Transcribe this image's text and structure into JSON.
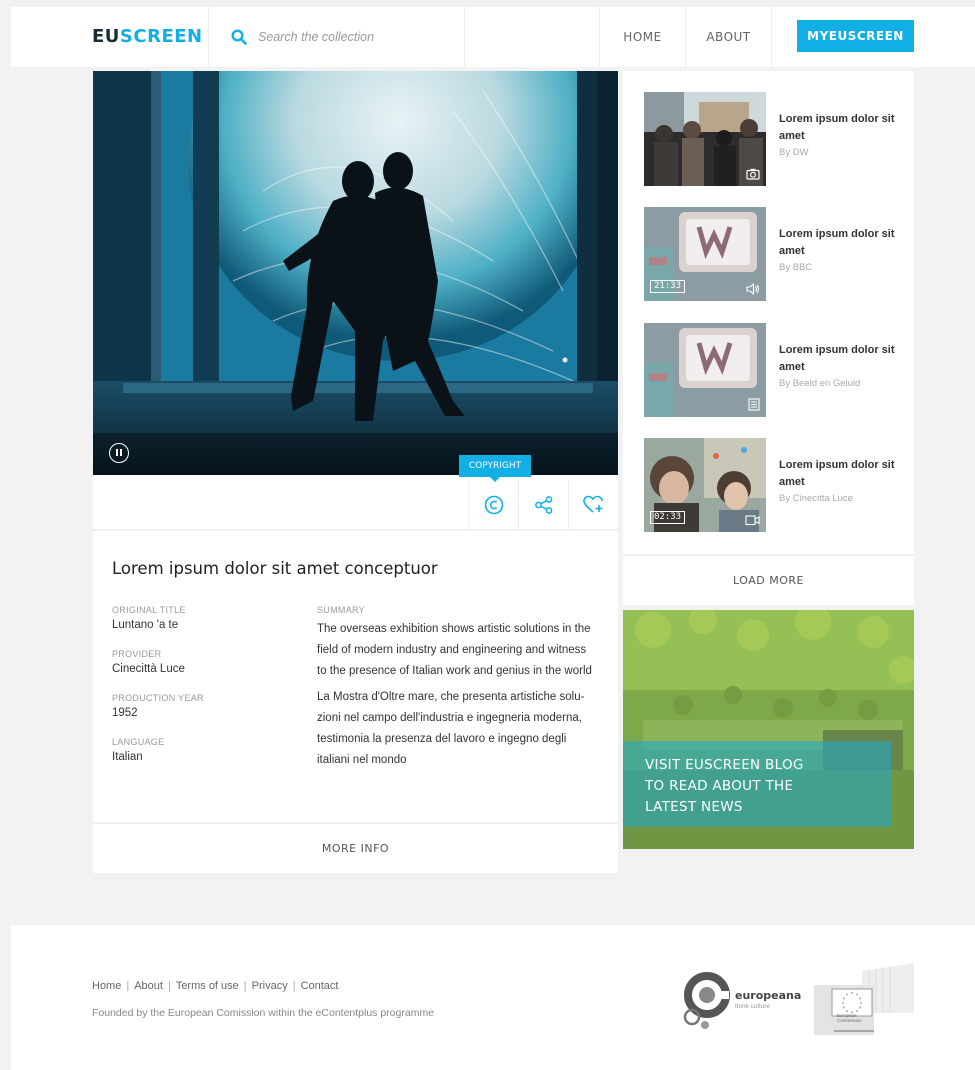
{
  "header": {
    "logo_part1": "EU",
    "logo_part2": "SCREEN",
    "search_placeholder": "Search the collection",
    "nav_home": "HOME",
    "nav_about": "ABOUT",
    "nav_my": "MYEUSCREEN"
  },
  "player": {
    "state": "playing",
    "tooltip": "COPYRIGHT"
  },
  "item": {
    "title": "Lorem ipsum dolor sit amet conceptuor",
    "meta": [
      {
        "label": "ORIGINAL TITLE",
        "value": "Luntano 'a te"
      },
      {
        "label": "PROVIDER",
        "value": "Cinecittà Luce"
      },
      {
        "label": "PRODUCTION YEAR",
        "value": "1952"
      },
      {
        "label": "LANGUAGE",
        "value": "Italian"
      }
    ],
    "summary_label": "SUMMARY",
    "summary_en": "The overseas exhibition shows artistic solutions in the field of modern industry and engineering and witness to the presence of Italian work and genius in the world",
    "summary_it": "La Mostra d'Oltre mare, che presenta artistiche solu-zioni nel campo dell'industria e ingegneria moderna, testimonia la presenza del lavoro e ingegno degli italiani nel mondo",
    "more_info": "MORE INFO"
  },
  "related": [
    {
      "title": "Lorem ipsum dolor sit amet",
      "by": "By DW",
      "duration": "",
      "type_icon": "camera-icon"
    },
    {
      "title": "Lorem ipsum dolor sit amet",
      "by": "By BBC",
      "duration": "21:33",
      "type_icon": "speaker-icon"
    },
    {
      "title": "Lorem ipsum dolor sit amet",
      "by": "By Beeld en Geluid",
      "duration": "",
      "type_icon": "document-icon"
    },
    {
      "title": "Lorem ipsum dolor sit amet",
      "by": "By Cinecitta Luce",
      "duration": "02:33",
      "type_icon": "video-camera-icon"
    }
  ],
  "load_more": "LOAD MORE",
  "blog": {
    "line1": "VISIT EUSCREEN BLOG",
    "line2": "TO READ ABOUT THE",
    "line3": "LATEST NEWS"
  },
  "footer": {
    "links": [
      "Home",
      "About",
      "Terms of use",
      "Privacy",
      "Contact"
    ],
    "note": "Founded by the European Comission within the eContentplus programme",
    "europeana_name": "europeana",
    "europeana_tagline": "think culture",
    "ec_name": "European Commission"
  },
  "colors": {
    "accent": "#12aee6",
    "logo_dark": "#1b2a36"
  }
}
